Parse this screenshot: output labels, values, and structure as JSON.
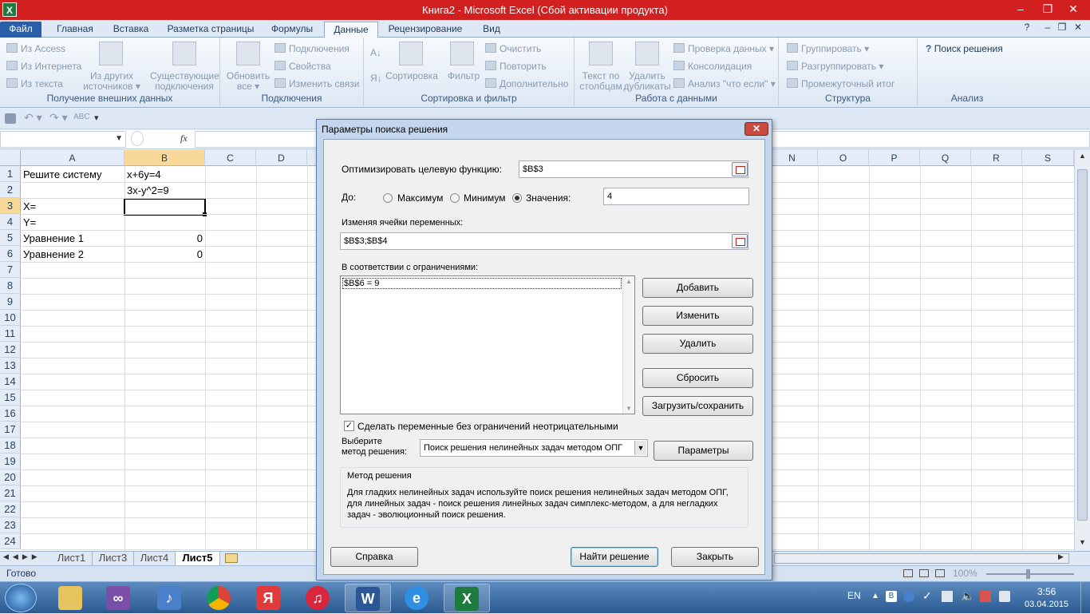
{
  "window": {
    "title": "Книга2 - Microsoft Excel (Сбой активации продукта)",
    "app_icon": "X"
  },
  "ribbon_tabs": [
    "Файл",
    "Главная",
    "Вставка",
    "Разметка страницы",
    "Формулы",
    "Данные",
    "Рецензирование",
    "Вид"
  ],
  "ribbon": {
    "groups": {
      "external": "Получение внешних данных",
      "connections": "Подключения",
      "sort_filter": "Сортировка и фильтр",
      "data_tools": "Работа с данными",
      "outline": "Структура",
      "analysis": "Анализ"
    },
    "from_access": "Из Access",
    "from_web": "Из Интернета",
    "from_text": "Из текста",
    "from_other_1": "Из других",
    "from_other_2": "источников",
    "existing_1": "Существующие",
    "existing_2": "подключения",
    "refresh_1": "Обновить",
    "refresh_2": "все",
    "connections": "Подключения",
    "properties": "Свойства",
    "edit_links": "Изменить связи",
    "sort": "Сортировка",
    "filter": "Фильтр",
    "clear": "Очистить",
    "reapply": "Повторить",
    "advanced": "Дополнительно",
    "text_to_cols_1": "Текст по",
    "text_to_cols_2": "столбцам",
    "remove_dup_1": "Удалить",
    "remove_dup_2": "дубликаты",
    "data_validation": "Проверка данных",
    "consolidate": "Консолидация",
    "what_if": "Анализ \"что если\"",
    "group": "Группировать",
    "ungroup": "Разгруппировать",
    "subtotal": "Промежуточный итог",
    "solver": "Поиск решения"
  },
  "formula_bar": {
    "fx": "fx"
  },
  "columns": [
    "A",
    "B",
    "C",
    "D",
    "N",
    "O",
    "P",
    "Q",
    "R",
    "S"
  ],
  "rows": [
    "1",
    "2",
    "3",
    "4",
    "5",
    "6",
    "7",
    "8",
    "9",
    "10",
    "11",
    "12",
    "13",
    "14",
    "15",
    "16",
    "17",
    "18",
    "19",
    "20",
    "21",
    "22",
    "23",
    "24"
  ],
  "cells": {
    "A1": "Решите систему",
    "B1": "x+6y=4",
    "B2": "3x-y^2=9",
    "A3": "X=",
    "A4": "Y=",
    "A5": "Уравнение 1",
    "B5": "0",
    "A6": "Уравнение 2",
    "B6": "0"
  },
  "sheets": [
    "Лист1",
    "Лист3",
    "Лист4",
    "Лист5"
  ],
  "status": {
    "ready": "Готово",
    "zoom": "100%"
  },
  "dialog": {
    "title": "Параметры поиска решения",
    "objective_label": "Оптимизировать целевую функцию:",
    "objective_value": "$B$3",
    "to_label": "До:",
    "max": "Максимум",
    "min": "Минимум",
    "value_of": "Значения:",
    "value": "4",
    "selected": "value_of",
    "changing_label": "Изменяя ячейки переменных:",
    "changing_value": "$B$3;$B$4",
    "constraints_label": "В соответствии с ограничениями:",
    "constraints": [
      "$B$6 = 9"
    ],
    "add": "Добавить",
    "change": "Изменить",
    "delete": "Удалить",
    "reset": "Сбросить",
    "load_save": "Загрузить/сохранить",
    "nonneg": "Сделать переменные без ограничений неотрицательными",
    "nonneg_checked": true,
    "method_label_1": "Выберите",
    "method_label_2": "метод решения:",
    "method": "Поиск решения нелинейных задач методом ОПГ",
    "options": "Параметры",
    "desc_title": "Метод решения",
    "desc_1": "Для гладких нелинейных задач используйте поиск решения нелинейных задач методом ОПГ,",
    "desc_2": "для линейных задач - поиск решения линейных задач симплекс-методом, а для негладких",
    "desc_3": "задач - эволюционный поиск решения.",
    "help": "Справка",
    "solve": "Найти решение",
    "close": "Закрыть"
  },
  "taskbar": {
    "lang": "EN",
    "time": "3:56",
    "date": "03.04.2015"
  }
}
